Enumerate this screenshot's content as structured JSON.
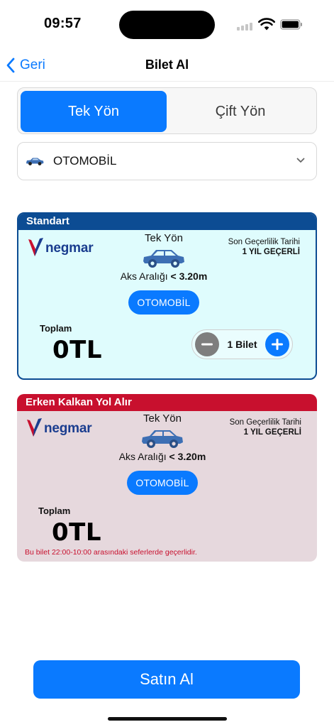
{
  "status_bar": {
    "time": "09:57"
  },
  "nav": {
    "back_label": "Geri",
    "title": "Bilet Al"
  },
  "direction_tabs": [
    {
      "label": "Tek Yön",
      "selected": true
    },
    {
      "label": "Çift Yön",
      "selected": false
    }
  ],
  "vehicle_select": {
    "value": "OTOMOBİL",
    "icon": "car-icon"
  },
  "tickets": [
    {
      "header": "Standart",
      "header_color": "#0c4c93",
      "background": "#dffcfd",
      "brand": "negmar",
      "direction": "Tek Yön",
      "axle_label": "Aks Aralığı",
      "axle_value": "< 3.20m",
      "vehicle": "OTOMOBİL",
      "validity_label": "Son Geçerlilik Tarihi",
      "validity_value": "1 YIL GEÇERLİ",
      "total_label": "Toplam",
      "total_value": "0TL",
      "count_label": "1 Bilet"
    },
    {
      "header": "Erken Kalkan Yol Alır",
      "header_color": "#c8102e",
      "background": "#e6d8dd",
      "brand": "negmar",
      "direction": "Tek Yön",
      "axle_label": "Aks Aralığı",
      "axle_value": "< 3.20m",
      "vehicle": "OTOMOBİL",
      "validity_label": "Son Geçerlilik Tarihi",
      "validity_value": "1 YIL GEÇERLİ",
      "total_label": "Toplam",
      "total_value": "0TL",
      "note": "Bu bilet 22:00-10:00 arasındaki seferlerde geçerlidir."
    }
  ],
  "buy_button": {
    "label": "Satın Al"
  },
  "colors": {
    "accent": "#0a7aff"
  }
}
